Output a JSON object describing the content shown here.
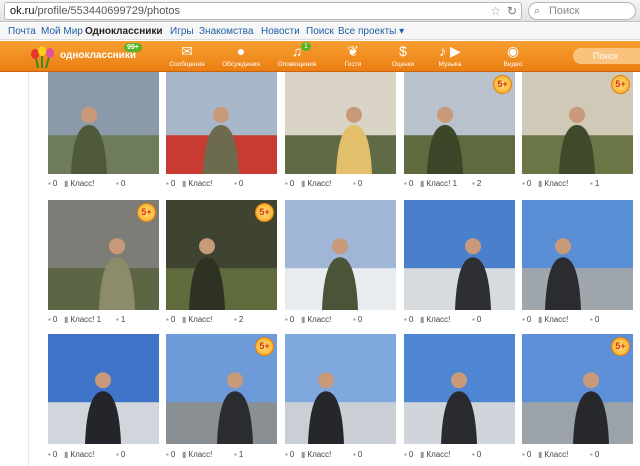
{
  "browser": {
    "url_domain": "ok.ru",
    "url_path": "/profile/553440699729/photos",
    "search_placeholder": "Поиск"
  },
  "topnav": {
    "items": [
      "Почта",
      "Мой Мир",
      "Одноклассники",
      "Игры",
      "Знакомства",
      "Новости",
      "Поиск",
      "Все проекты ▾"
    ]
  },
  "header": {
    "logo_text": "одноклассники",
    "logo_badge": "99+",
    "icons": [
      {
        "label": "Сообщения",
        "icon": "envelope-icon",
        "badge": ""
      },
      {
        "label": "Обсуждения",
        "icon": "chat-bubbles-icon",
        "badge": ""
      },
      {
        "label": "Оповещения",
        "icon": "bell-icon",
        "badge": "1"
      },
      {
        "label": "Гости",
        "icon": "footprints-icon",
        "badge": ""
      },
      {
        "label": "Оценки",
        "icon": "rating-icon",
        "badge": ""
      },
      {
        "label": "Музыка",
        "icon": "music-note-icon",
        "badge": ""
      },
      {
        "label": "Видео",
        "icon": "video-camera-icon",
        "badge": ""
      }
    ],
    "search_placeholder": "Поиск"
  },
  "colors": {
    "accent": "#ee8208",
    "link": "#1f5fa8"
  },
  "photos": [
    {
      "comments": "0",
      "likes_label": "Класс!",
      "likes": "0",
      "five": false
    },
    {
      "comments": "0",
      "likes_label": "Класс!",
      "likes": "0",
      "five": false
    },
    {
      "comments": "0",
      "likes_label": "Класс!",
      "likes": "0",
      "five": false
    },
    {
      "comments": "0",
      "likes_label": "Класс! 1",
      "likes": "2",
      "five": true
    },
    {
      "comments": "0",
      "likes_label": "Класс!",
      "likes": "1",
      "five": true
    },
    {
      "comments": "0",
      "likes_label": "Класс! 1",
      "likes": "1",
      "five": true
    },
    {
      "comments": "0",
      "likes_label": "Класс!",
      "likes": "2",
      "five": true
    },
    {
      "comments": "0",
      "likes_label": "Класс!",
      "likes": "0",
      "five": false
    },
    {
      "comments": "0",
      "likes_label": "Класс!",
      "likes": "0",
      "five": false
    },
    {
      "comments": "0",
      "likes_label": "Класс!",
      "likes": "0",
      "five": false
    },
    {
      "comments": "0",
      "likes_label": "Класс!",
      "likes": "0",
      "five": false
    },
    {
      "comments": "0",
      "likes_label": "Класс!",
      "likes": "1",
      "five": true
    },
    {
      "comments": "0",
      "likes_label": "Класс!",
      "likes": "0",
      "five": false
    },
    {
      "comments": "0",
      "likes_label": "Класс!",
      "likes": "0",
      "five": false
    },
    {
      "comments": "0",
      "likes_label": "Класс!",
      "likes": "0",
      "five": true
    }
  ],
  "five_label": "5+"
}
